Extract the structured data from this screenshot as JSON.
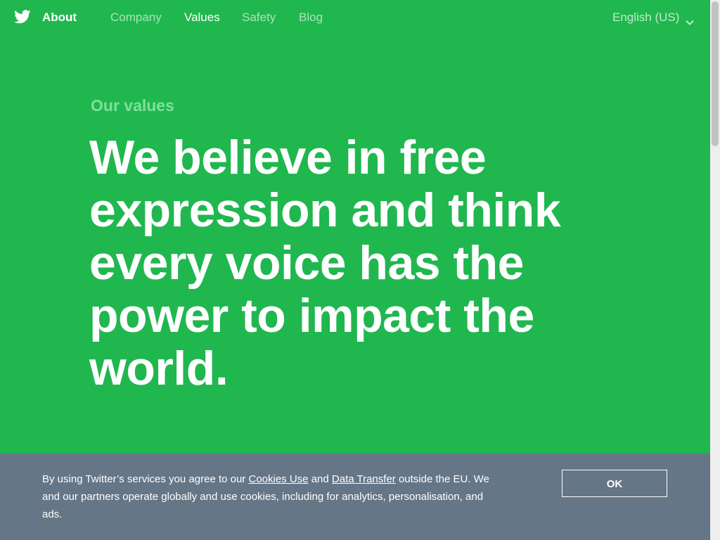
{
  "nav": {
    "logo_icon": "twitter-bird-icon",
    "brand": "About",
    "links": [
      {
        "label": "Company"
      },
      {
        "label": "Values"
      },
      {
        "label": "Safety"
      },
      {
        "label": "Blog"
      }
    ],
    "active_link": "Values",
    "language": "English (US)",
    "language_icon": "chevron-down-icon"
  },
  "hero": {
    "eyebrow": "Our values",
    "headline": "We believe in free expression and think every voice has the power to impact the world."
  },
  "cookie_banner": {
    "text_before": "By using Twitter’s services you agree to our ",
    "link_cookies": "Cookies Use",
    "text_and": " and ",
    "link_transfer": "Data Transfer",
    "text_after": " outside the EU. We and our partners operate globally and use cookies, including for analytics, personalisation, and ads.",
    "ok_label": "OK"
  },
  "colors": {
    "background": "#20b74f",
    "eyebrow": "#7fe09c",
    "banner": "#657686",
    "text": "#ffffff"
  }
}
